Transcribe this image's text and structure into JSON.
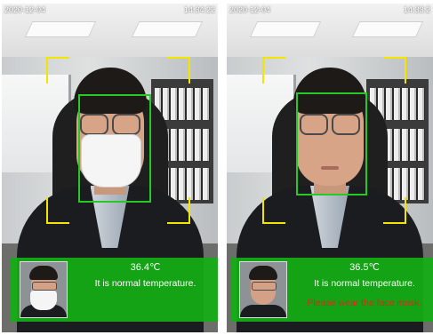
{
  "left_screen": {
    "date": "2020-12-04",
    "time": "14:34:22",
    "temperature": "36.4℃",
    "message": "It is normal temperature."
  },
  "right_screen": {
    "date": "2020-12-04",
    "time": "14:33:2",
    "temperature": "36.5℃",
    "message": "It is normal temperature.",
    "warning": "Please wear the face mask."
  },
  "colors": {
    "frame_corners": "#f2e600",
    "face_box": "#26c926",
    "panel": "#14af14",
    "warning": "#e0261b"
  }
}
